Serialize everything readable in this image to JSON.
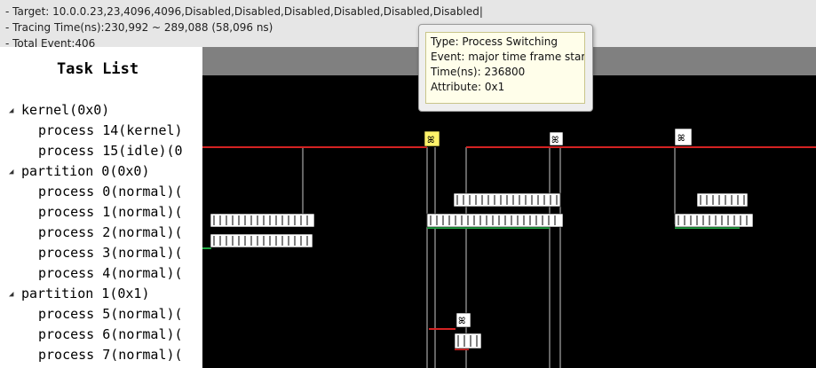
{
  "info": {
    "target": "- Target: 10.0.0.23,23,4096,4096,Disabled,Disabled,Disabled,Disabled,Disabled,Disabled|",
    "tracing_time": "- Tracing Time(ns):230,992 ~ 289,088 (58,096 ns)",
    "total_event": "- Total Event:406"
  },
  "task_list": {
    "title": "Task List",
    "rows": [
      {
        "label": "kernel(0x0)",
        "group": true
      },
      {
        "label": "process 14(kernel)",
        "group": false
      },
      {
        "label": "process 15(idle)(0",
        "group": false
      },
      {
        "label": "partition 0(0x0)",
        "group": true
      },
      {
        "label": "process 0(normal)(",
        "group": false
      },
      {
        "label": "process 1(normal)(",
        "group": false
      },
      {
        "label": "process 2(normal)(",
        "group": false
      },
      {
        "label": "process 3(normal)(",
        "group": false
      },
      {
        "label": "process 4(normal)(",
        "group": false
      },
      {
        "label": "partition 1(0x1)",
        "group": true
      },
      {
        "label": "process 5(normal)(",
        "group": false
      },
      {
        "label": "process 6(normal)(",
        "group": false
      },
      {
        "label": "process 7(normal)(",
        "group": false
      }
    ]
  },
  "tooltip": {
    "type": "Type: Process Switching",
    "event": "Event: major time frame star",
    "time": "Time(ns): 236800",
    "attribute": "Attribute: 0x1"
  },
  "colors": {
    "timeline_bg": "#000000",
    "header_bg": "#808080",
    "idle_line": "#d42222",
    "run_line": "#22aa44",
    "marker": "#ffffff",
    "highlight_marker": "#fff36a"
  },
  "marker_glyph": "ꕤ"
}
